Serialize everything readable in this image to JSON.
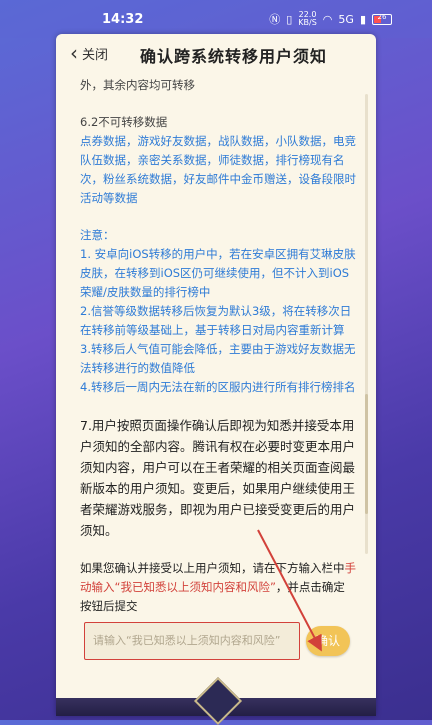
{
  "status_bar": {
    "time": "14:32",
    "network_speed_value": "22.0",
    "network_speed_unit": "KB/S",
    "signal": "5G",
    "battery_level": "26"
  },
  "header": {
    "back_label": "关闭",
    "title": "确认跨系统转移用户须知"
  },
  "content": {
    "line_0": "外，其余内容均可转移",
    "section_6_2_title": "6.2不可转移数据",
    "section_6_2_items": "点券数据，游戏好友数据，战队数据，小队数据，电竞队伍数据，亲密关系数据，师徒数据，排行榜现有名次，粉丝系统数据，好友邮件中金币赠送，设备段限时活动等数据",
    "notice_title": "注意：",
    "notice_1": "1. 安卓向iOS转移的用户中，若在安卓区拥有艾琳皮肤皮肤，在转移到iOS区仍可继续使用，但不计入到iOS荣耀/皮肤数量的排行榜中",
    "notice_2": "2.信誉等级数据转移后恢复为默认3级，将在转移次日在转移前等级基础上，基于转移日对局内容重新计算",
    "notice_3": "3.转移后人气值可能会降低，主要由于游戏好友数据无法转移进行的数值降低",
    "notice_4": "4.转移后一周内无法在新的区服内进行所有排行榜排名",
    "clause_7": "7.用户按照页面操作确认后即视为知悉并接受本用户须知的全部内容。腾讯有权在必要时变更本用户须知内容，用户可以在王者荣耀的相关页面查阅最新版本的用户须知。变更后，如果用户继续使用王者荣耀游戏服务，即视为用户已接受变更后的用户须知。",
    "instruction_before": "如果您确认并接受以上用户须知，请在下方输入栏中",
    "instruction_highlight": "手动输入“我已知悉以上须知内容和风险”",
    "instruction_after": "，并点击确定按钮后提交"
  },
  "input": {
    "placeholder": "请输入“我已知悉以上须知内容和风险”"
  },
  "confirm_button": {
    "label": "确认"
  },
  "colors": {
    "accent_blue": "#2e7bd6",
    "confirm_yellow": "#f2c457",
    "highlight_red": "#d2413a",
    "card_bg": "#fbf6e8"
  }
}
